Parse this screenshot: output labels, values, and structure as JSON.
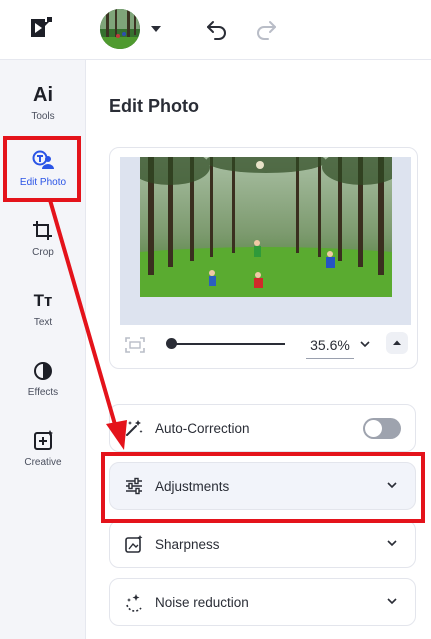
{
  "rail": {
    "items": [
      {
        "label": "Tools",
        "icon": "ai-tools-icon"
      },
      {
        "label": "Edit Photo",
        "icon": "edit-photo-icon"
      },
      {
        "label": "Crop",
        "icon": "crop-icon"
      },
      {
        "label": "Text",
        "icon": "text-icon"
      },
      {
        "label": "Effects",
        "icon": "effects-icon"
      },
      {
        "label": "Creative",
        "icon": "creative-icon"
      }
    ],
    "ai_glyph": "Ai",
    "text_glyph": "Tт"
  },
  "main": {
    "title": "Edit Photo",
    "zoom": {
      "value": "35.6%"
    },
    "panels": [
      {
        "label": "Auto-Correction",
        "toggle_on": false
      },
      {
        "label": "Adjustments"
      },
      {
        "label": "Sharpness"
      },
      {
        "label": "Noise reduction"
      }
    ]
  },
  "colors": {
    "accent": "#2a54e6",
    "annotation_red": "#e4131b",
    "rail_bg": "#f4f5f9"
  }
}
